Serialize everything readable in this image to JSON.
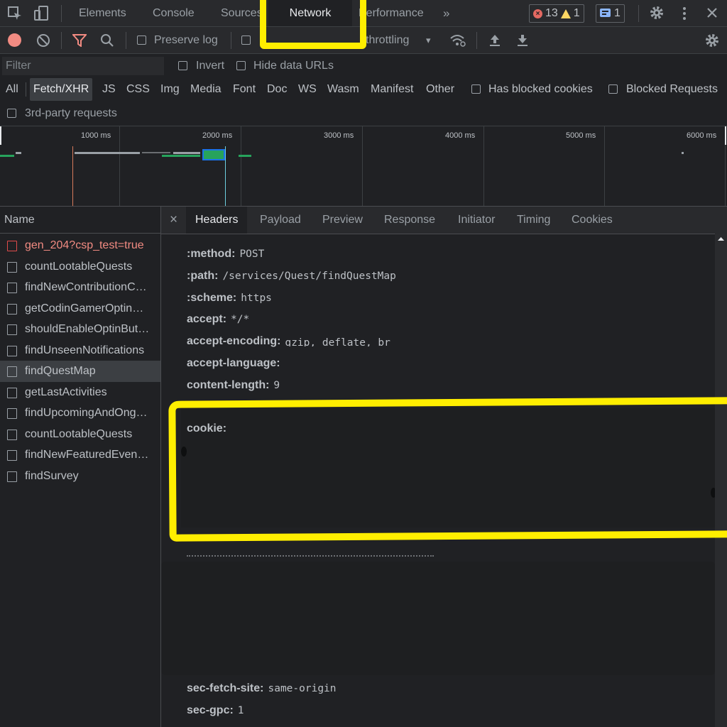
{
  "top_tabs": [
    "Elements",
    "Console",
    "Sources",
    "Network",
    "Performance"
  ],
  "active_tab": "Network",
  "more_tabs": "»",
  "counts": {
    "errors": "13",
    "warnings": "1",
    "messages": "1"
  },
  "toolbar": {
    "preserve_log": "Preserve log",
    "throttling": "throttling",
    "throttle_arrow": "▾"
  },
  "filter": {
    "placeholder": "Filter",
    "invert": "Invert",
    "hide_data_urls": "Hide data URLs"
  },
  "types": [
    "All",
    "Fetch/XHR",
    "JS",
    "CSS",
    "Img",
    "Media",
    "Font",
    "Doc",
    "WS",
    "Wasm",
    "Manifest",
    "Other"
  ],
  "active_type": "Fetch/XHR",
  "has_blocked_cookies": "Has blocked cookies",
  "blocked_requests": "Blocked Requests",
  "third_party": "3rd-party requests",
  "timeline_ticks": [
    "1000 ms",
    "2000 ms",
    "3000 ms",
    "4000 ms",
    "5000 ms",
    "6000 ms"
  ],
  "name_header": "Name",
  "requests": [
    "gen_204?csp_test=true",
    "countLootableQuests",
    "findNewContributionC…",
    "getCodinGamerOptin…",
    "shouldEnableOptinBut…",
    "findUnseenNotifications",
    "findQuestMap",
    "getLastActivities",
    "findUpcomingAndOng…",
    "countLootableQuests",
    "findNewFeaturedEven…",
    "findSurvey"
  ],
  "selected_request": "findQuestMap",
  "detail_close": "×",
  "detail_tabs": [
    "Headers",
    "Payload",
    "Preview",
    "Response",
    "Initiator",
    "Timing",
    "Cookies"
  ],
  "active_detail_tab": "Headers",
  "headers": [
    {
      "key": ":method:",
      "value": "POST"
    },
    {
      "key": ":path:",
      "value": "/services/Quest/findQuestMap"
    },
    {
      "key": ":scheme:",
      "value": "https"
    },
    {
      "key": "accept:",
      "value": "*/*"
    },
    {
      "key": "accept-encoding:",
      "value": "gzip, deflate, br"
    },
    {
      "key": "accept-language:",
      "value": ""
    },
    {
      "key": "content-length:",
      "value": "9"
    },
    {
      "key": "cookie:",
      "value": ""
    },
    {
      "key": "sec-fetch-site:",
      "value": "same-origin"
    },
    {
      "key": "sec-gpc:",
      "value": "1"
    }
  ],
  "highlight_color": "#ffee00"
}
